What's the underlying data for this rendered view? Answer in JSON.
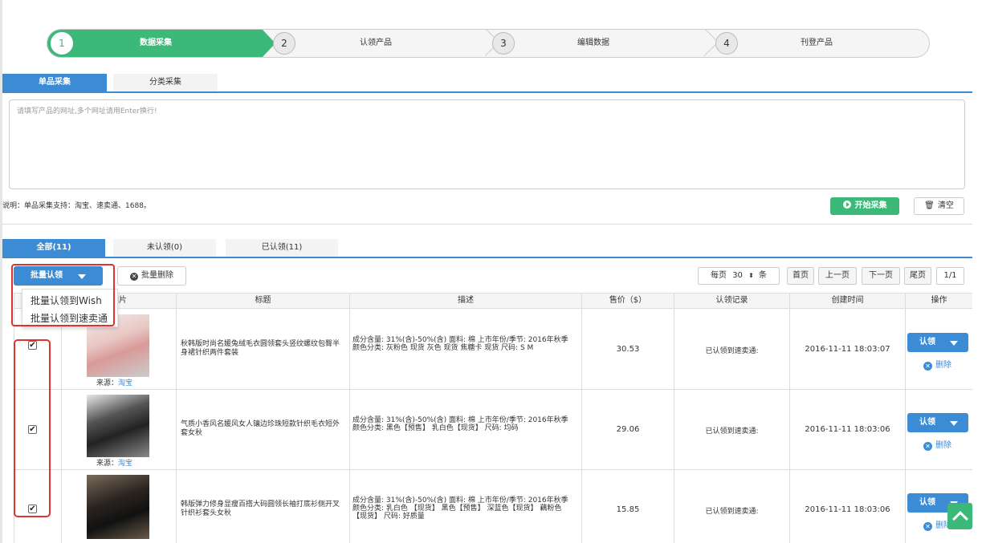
{
  "steps": [
    {
      "num": "1",
      "label": "数据采集"
    },
    {
      "num": "2",
      "label": "认领产品"
    },
    {
      "num": "3",
      "label": "编辑数据"
    },
    {
      "num": "4",
      "label": "刊登产品"
    }
  ],
  "collect_tabs": [
    "单品采集",
    "分类采集"
  ],
  "url_input": {
    "placeholder": "请填写产品的网址,多个网址请用Enter换行!"
  },
  "note": "说明：单品采集支持：淘宝、速卖通、1688。",
  "start_button": "开始采集",
  "clear_button": "清空",
  "filter_tabs": [
    "全部(11)",
    "未认领(0)",
    "已认领(11)"
  ],
  "toolbar": {
    "batch_claim": "批量认领",
    "batch_delete": "批量删除",
    "dropdown": [
      "批量认领到Wish",
      "批量认领到速卖通"
    ]
  },
  "pager": {
    "per_page_prefix": "每页",
    "per_page_value": "30",
    "per_page_suffix": "条",
    "first": "首页",
    "prev": "上一页",
    "next": "下一页",
    "last": "尾页",
    "page": "1/1"
  },
  "table": {
    "headers": [
      "图片",
      "标题",
      "描述",
      "售价（$）",
      "认领记录",
      "创建时间",
      "操作"
    ],
    "rows": [
      {
        "source_label": "来源：",
        "source": "淘宝",
        "title": "秋韩版时尚名媛兔绒毛衣圆领套头竖纹螺纹包臀半身裙针织两件套装",
        "desc": "成分含量: 31%(含)-50%(含) 面料: 棉 上市年份/季节: 2016年秋季 颜色分类: 灰粉色 现货 灰色 现货 焦糖卡 现货 尺码: S M",
        "price": "30.53",
        "record": "已认领到速卖通:",
        "created": "2016-11-11 18:03:07",
        "op": "认领",
        "del": "删除",
        "checked": "✔"
      },
      {
        "source_label": "来源：",
        "source": "淘宝",
        "title": "气质小香风名媛风女人镶边珍珠短款针织毛衣短外套女秋",
        "desc": "成分含量: 31%(含)-50%(含) 面料: 棉 上市年份/季节: 2016年秋季 颜色分类: 黑色【预售】 乳白色【现货】 尺码: 均码",
        "price": "29.06",
        "record": "已认领到速卖通:",
        "created": "2016-11-11 18:03:06",
        "op": "认领",
        "del": "删除",
        "checked": "✔"
      },
      {
        "source_label": "",
        "source": "",
        "title": "韩版弹力修身显瘦百搭大码圆领长袖打底衫侧开叉针织衫套头女秋",
        "desc": "成分含量: 31%(含)-50%(含) 面料: 棉 上市年份/季节: 2016年秋季 颜色分类: 乳白色 【现货】 黑色【预售】 深蓝色【现货】 藕粉色【现货】 尺码: 好质量",
        "price": "15.85",
        "record": "已认领到速卖通:",
        "created": "2016-11-11 18:03:06",
        "op": "认领",
        "del": "删除",
        "checked": "✔"
      }
    ]
  },
  "colors": {
    "green": "#3cb878",
    "blue": "#3b8bd5",
    "red": "#e0332e"
  }
}
